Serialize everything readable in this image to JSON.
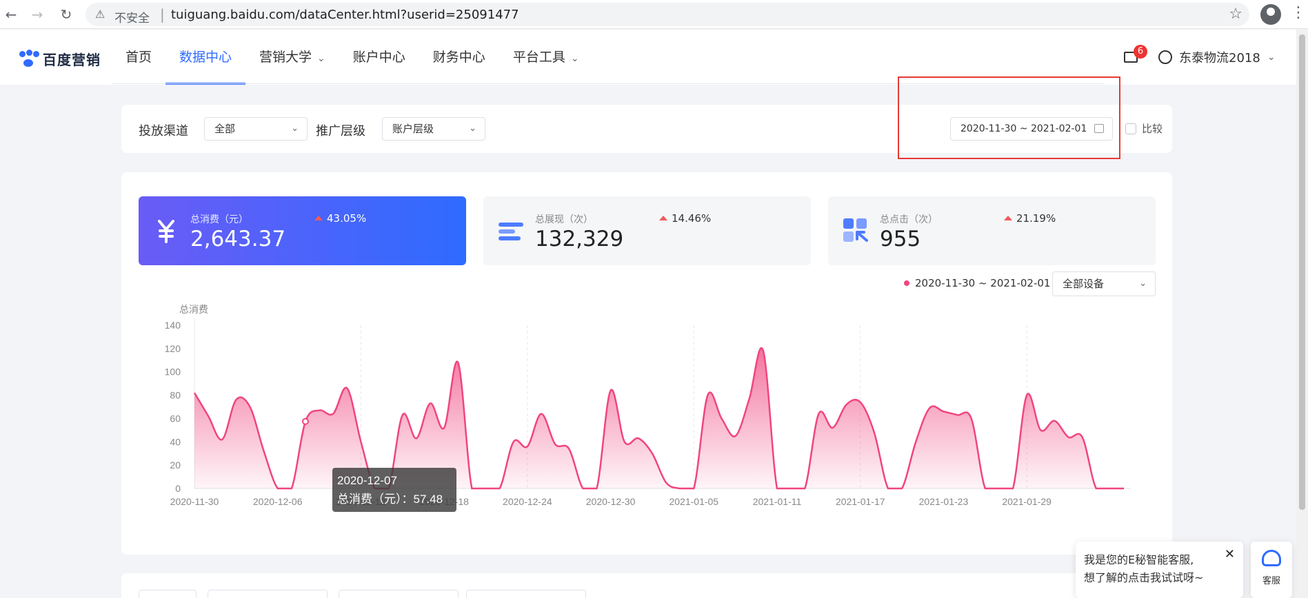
{
  "browser": {
    "insecure_label": "不安全",
    "separator": "|",
    "url": "tuiguang.baidu.com/dataCenter.html?userid=25091477"
  },
  "header": {
    "logo_text": "百度营销",
    "nav": [
      {
        "label": "首页"
      },
      {
        "label": "数据中心"
      },
      {
        "label": "营销大学"
      },
      {
        "label": "账户中心"
      },
      {
        "label": "财务中心"
      },
      {
        "label": "平台工具"
      }
    ],
    "mail_badge": "6",
    "username": "东泰物流2018"
  },
  "filters": {
    "channel_label": "投放渠道",
    "channel_value": "全部",
    "level_label": "推广层级",
    "level_value": "账户层级",
    "date_range": "2020-11-30 ~ 2021-02-01",
    "compare_label": "比较"
  },
  "kpis": [
    {
      "label": "总消费（元）",
      "value": "2,643.37",
      "delta": "43.05%",
      "icon": "yen-icon"
    },
    {
      "label": "总展现（次）",
      "value": "132,329",
      "delta": "14.46%",
      "icon": "bars-icon"
    },
    {
      "label": "总点击（次）",
      "value": "955",
      "delta": "21.19%",
      "icon": "grid-cursor-icon"
    }
  ],
  "chart_controls": {
    "legend_range": "2020-11-30 ~ 2021-02-01",
    "device": "全部设备"
  },
  "tooltip": {
    "date": "2020-12-07",
    "text": "总消费（元）：57.48"
  },
  "chat": {
    "line1": "我是您的E秘智能客服,",
    "line2": "想了解的点击我试试呀~",
    "service_label": "客服"
  },
  "chart_data": {
    "type": "area",
    "ylabel": "总消费",
    "ylim": [
      0,
      140
    ],
    "yticks": [
      0,
      20,
      40,
      60,
      80,
      100,
      120,
      140
    ],
    "xtick_labels": [
      "2020-11-30",
      "2020-12-06",
      "2020-12-12",
      "2020-12-18",
      "2020-12-24",
      "2020-12-30",
      "2021-01-05",
      "2021-01-11",
      "2021-01-17",
      "2021-01-23",
      "2021-01-29"
    ],
    "x_start": "2020-11-30",
    "x_end": "2021-02-01",
    "series": [
      {
        "color": "#f0457e",
        "values": [
          82,
          62,
          42,
          76,
          70,
          32,
          0,
          0,
          57.48,
          67,
          64,
          86,
          40,
          0,
          0,
          63,
          43,
          73,
          52,
          108,
          0,
          0,
          0,
          40,
          36,
          64,
          38,
          34,
          0,
          0,
          84,
          40,
          43,
          30,
          5,
          0,
          0,
          80,
          60,
          45,
          77,
          118,
          0,
          0,
          0,
          64,
          52,
          72,
          74,
          48,
          0,
          0,
          40,
          69,
          66,
          63,
          60,
          0,
          0,
          0,
          80,
          50,
          58,
          44,
          44,
          0,
          0,
          0
        ]
      }
    ]
  }
}
